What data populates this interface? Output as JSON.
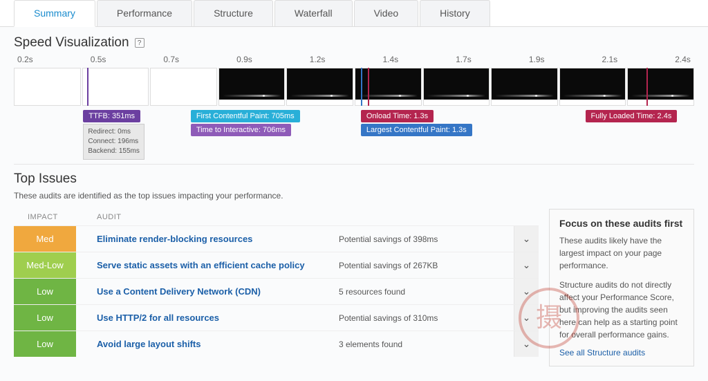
{
  "tabs": [
    "Summary",
    "Performance",
    "Structure",
    "Waterfall",
    "Video",
    "History"
  ],
  "active_tab": 0,
  "speed_viz": {
    "title": "Speed Visualization",
    "times": [
      "0.2s",
      "0.5s",
      "0.7s",
      "0.9s",
      "1.2s",
      "1.4s",
      "1.7s",
      "1.9s",
      "2.1s",
      "2.4s"
    ],
    "ttfb": {
      "label": "TTFB: 351ms",
      "details": [
        "Redirect: 0ms",
        "Connect: 196ms",
        "Backend: 155ms"
      ]
    },
    "fcp": "First Contentful Paint: 705ms",
    "tti": "Time to Interactive: 706ms",
    "onload": "Onload Time: 1.3s",
    "lcp": "Largest Contentful Paint: 1.3s",
    "fully_loaded": "Fully Loaded Time: 2.4s"
  },
  "top_issues": {
    "title": "Top Issues",
    "subtitle": "These audits are identified as the top issues impacting your performance.",
    "headers": {
      "impact": "IMPACT",
      "audit": "AUDIT"
    },
    "rows": [
      {
        "impact": "Med",
        "impact_class": "impact-med",
        "audit": "Eliminate render-blocking resources",
        "detail": "Potential savings of 398ms"
      },
      {
        "impact": "Med-Low",
        "impact_class": "impact-medlow",
        "audit": "Serve static assets with an efficient cache policy",
        "detail": "Potential savings of 267KB"
      },
      {
        "impact": "Low",
        "impact_class": "impact-low",
        "audit": "Use a Content Delivery Network (CDN)",
        "detail": "5 resources found"
      },
      {
        "impact": "Low",
        "impact_class": "impact-low",
        "audit": "Use HTTP/2 for all resources",
        "detail": "Potential savings of 310ms"
      },
      {
        "impact": "Low",
        "impact_class": "impact-low",
        "audit": "Avoid large layout shifts",
        "detail": "3 elements found"
      }
    ]
  },
  "sidebar": {
    "title": "Focus on these audits first",
    "p1": "These audits likely have the largest impact on your page performance.",
    "p2": "Structure audits do not directly affect your Performance Score, but improving the audits seen here can help as a starting point for overall performance gains.",
    "link": "See all Structure audits"
  }
}
